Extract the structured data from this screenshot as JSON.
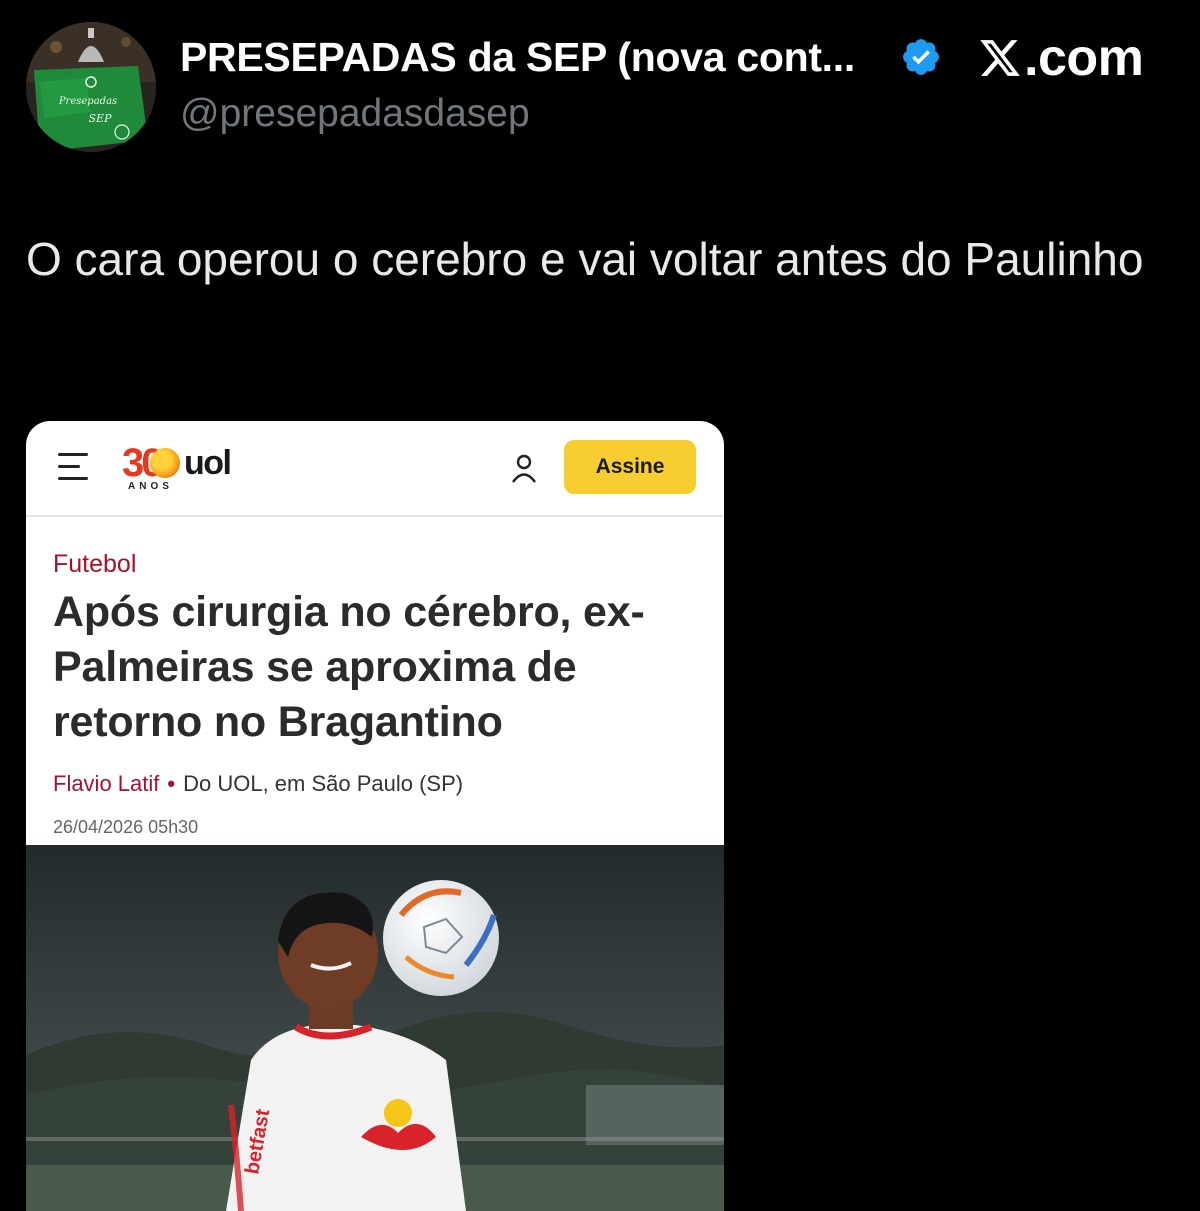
{
  "tweet": {
    "display_name": "PRESEPADAS da SEP (nova cont...",
    "handle": "@presepadasdasep",
    "brand_suffix": ".com",
    "text": "O cara operou o cerebro e vai voltar antes do Paulinho",
    "avatar_text": {
      "line1": "Presepadas",
      "line2": "SEP"
    },
    "icons": [
      "avatar-photo",
      "verified-badge-icon",
      "x-logo-icon"
    ],
    "colors": {
      "background": "#000000",
      "verified": "#1d9bf0",
      "handle": "#71767b"
    }
  },
  "article": {
    "site": {
      "number": "30",
      "word": "uol",
      "anos": "ANOS"
    },
    "subscribe_label": "Assine",
    "section": "Futebol",
    "headline": "Após cirurgia no cérebro, ex-Palmeiras se aproxima de retorno no Bragantino",
    "author": "Flavio Latif",
    "location": "Do UOL, em São Paulo (SP)",
    "date": "26/04/2026 05h30",
    "icons": [
      "hamburger-menu-icon",
      "user-icon"
    ],
    "photo_text": {
      "shirt_sponsor": "betfast"
    },
    "colors": {
      "accent": "#a4132c",
      "button": "#f7cd2f",
      "logo_red": "#e8381f"
    }
  }
}
